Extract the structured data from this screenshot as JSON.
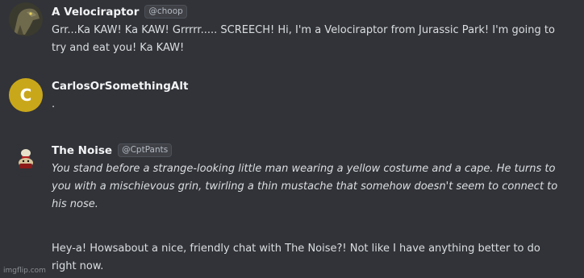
{
  "messages": [
    {
      "username": "A Velociraptor",
      "handle": "@choop",
      "avatar_icon": "velociraptor-avatar-icon",
      "text": "Grr...Ka KAW!  Ka KAW!  Grrrrr.....  SCREECH!  Hi, I'm a Velociraptor from Jurassic Park!  I'm going to try and eat you!  Ka KAW!"
    },
    {
      "username": "CarlosOrSomethingAlt",
      "avatar_letter": "C",
      "avatar_color": "#c9a71a",
      "text": "."
    },
    {
      "username": "The Noise",
      "handle": "@CptPants",
      "avatar_icon": "the-noise-avatar-icon",
      "italic_text": "You stand before a strange-looking little man wearing a yellow costume and a cape. He turns to you with a mischievous grin, twirling a thin mustache that somehow doesn't seem to connect to his nose.",
      "text": "Hey-a! Howsabout a nice, friendly chat with The Noise?! Not like I have anything better to do right now."
    }
  ],
  "watermark": "imgflip.com",
  "colors": {
    "background": "#313338",
    "username": "#f2f3f5",
    "message_text": "#dbdee1"
  }
}
